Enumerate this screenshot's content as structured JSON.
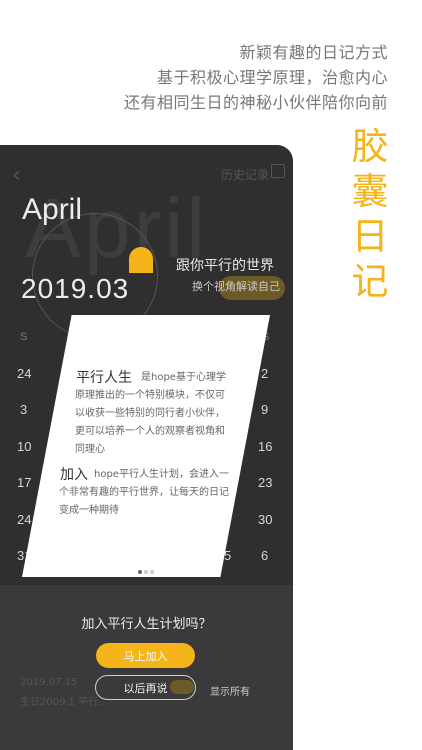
{
  "tagline": [
    "新颖有趣的日记方式",
    "基于积极心理学原理，治愈内心",
    "还有相同生日的神秘小伙伴陪你向前"
  ],
  "brand_chars": [
    "胶",
    "囊",
    "日",
    "记"
  ],
  "phone": {
    "history_label": "历史记录",
    "month": "April",
    "month_watermark": "April",
    "date": "2019.03",
    "parallel_title": "跟你平行的世界",
    "parallel_subtitle": "换个视角解读自己",
    "calendar": {
      "weekday_letters": [
        "S",
        "S"
      ],
      "left_col": [
        "24",
        "3",
        "10",
        "17",
        "24",
        "31"
      ],
      "right_col": [
        "2",
        "9",
        "16",
        "23",
        "30",
        "6"
      ],
      "extra": [
        "5"
      ]
    },
    "card": {
      "title1": "平行人生",
      "body1": "是hope基于心理学原理推出的一个特别模块，不仅可以收获一些特别的同行者小伙伴，更可以培养一个人的观察者视角和同理心",
      "title2": "加入",
      "body2": "hope平行人生计划，会进入一个非常有趣的平行世界，让每天的日记变成一种期待",
      "pages": 3,
      "active_page": 0
    },
    "prompt": {
      "question": "加入平行人生计划吗？",
      "join_label": "马上加入",
      "later_label": "以后再说",
      "show_all_label": "显示所有"
    },
    "ghost_rows": [
      "2019.07.15",
      "生日2009.1 平行..."
    ]
  },
  "colors": {
    "accent": "#f4b41a",
    "phone_bg": "#2f2f2f"
  }
}
